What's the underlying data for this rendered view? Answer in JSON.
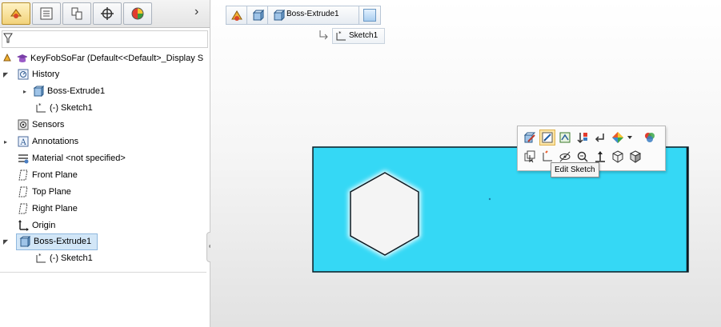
{
  "tabs": [
    {
      "icon": "feature-manager-icon"
    },
    {
      "icon": "property-manager-icon"
    },
    {
      "icon": "configuration-manager-icon"
    },
    {
      "icon": "dimxpert-icon"
    },
    {
      "icon": "display-manager-icon"
    }
  ],
  "tabs_more": "›",
  "tree": {
    "root": "KeyFobSoFar  (Default<<Default>_Display S",
    "items": [
      {
        "label": "History"
      },
      {
        "label": "Boss-Extrude1"
      },
      {
        "label": "(-) Sketch1"
      },
      {
        "label": "Sensors"
      },
      {
        "label": "Annotations"
      },
      {
        "label": "Material <not specified>"
      },
      {
        "label": "Front Plane"
      },
      {
        "label": "Top Plane"
      },
      {
        "label": "Right Plane"
      },
      {
        "label": "Origin"
      },
      {
        "label": "Boss-Extrude1"
      },
      {
        "label": "(-) Sketch1"
      }
    ]
  },
  "breadcrumb": {
    "feature": "Boss-Extrude1",
    "sketch": "Sketch1"
  },
  "tooltip": "Edit Sketch",
  "colors": {
    "part": "#35d8f5",
    "part_edge": "#0d1a22",
    "selection": "#d2e6f7",
    "tooltip_bg": "#f4f4f4"
  }
}
